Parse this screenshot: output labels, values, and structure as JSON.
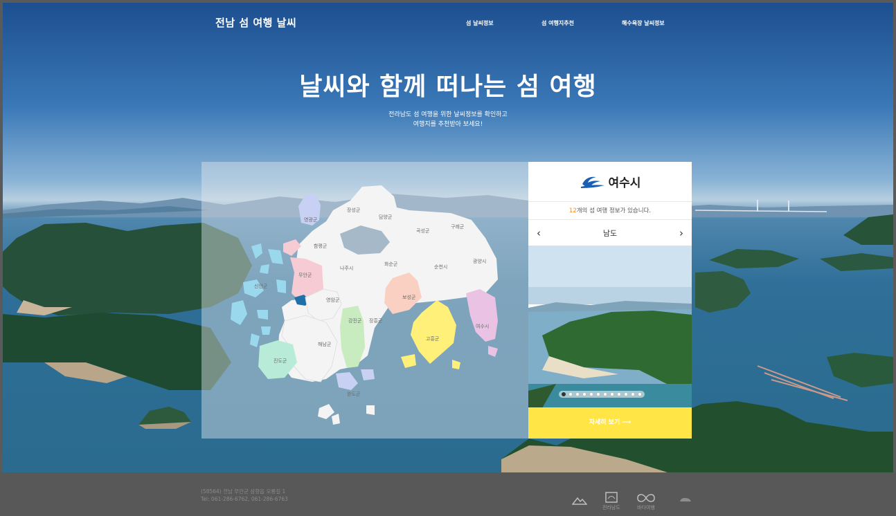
{
  "header": {
    "site_title": "전남 섬 여행 날씨",
    "nav": [
      "섬 날씨정보",
      "섬 여행지추천",
      "해수욕장 날씨정보"
    ]
  },
  "hero": {
    "headline": "날씨와 함께 떠나는 섬 여행",
    "subline_1": "전라남도 섬 여행을 위한 날씨정보를 확인하고",
    "subline_2": "여행지를 추천받아 보세요!"
  },
  "map": {
    "regions": [
      "영광군",
      "장성군",
      "담양군",
      "곡성군",
      "구례군",
      "함평군",
      "무안군",
      "나주시",
      "화순군",
      "순천시",
      "광양시",
      "신안군",
      "영암군",
      "보성군",
      "강진군",
      "장흥군",
      "여수시",
      "해남군",
      "고흥군",
      "진도군",
      "완도군"
    ],
    "selected_region": "목포시",
    "colors": {
      "land": "#f4f4f4",
      "selected": "#1f6fa8"
    }
  },
  "card": {
    "city_name": "여수시",
    "count_number": "12",
    "count_suffix": "개의 섬 여행 정보가 있습니다.",
    "prev_arrow": "‹",
    "next_arrow": "›",
    "island_name": "남도",
    "slide_total": 12,
    "slide_active": 1,
    "detail_button": "자세히 보기 ⟶",
    "button_color": "#ffe545"
  },
  "footer": {
    "address_line1": "(58564) 전남 무안군 삼향읍 오룡길 1",
    "address_line2": "Tel: 061-286-6762, 061-286-6763",
    "logos": [
      "",
      "전라남도",
      "바다여행",
      ""
    ]
  }
}
